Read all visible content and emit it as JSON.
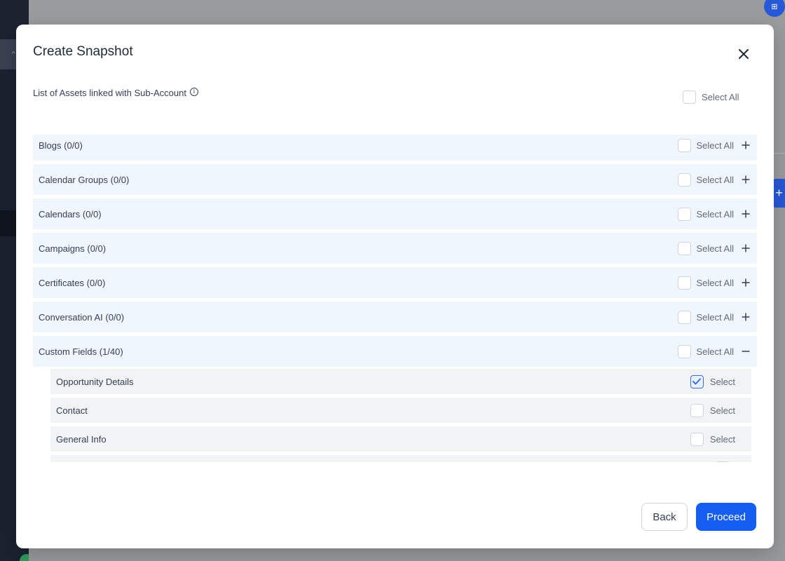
{
  "modal": {
    "title": "Create Snapshot",
    "assets_header": "List of Assets linked with Sub-Account",
    "global_select_all": "Select All"
  },
  "groups": [
    {
      "label": "Blogs (0/0)",
      "select_label": "Select All",
      "expanded": false
    },
    {
      "label": "Calendar Groups (0/0)",
      "select_label": "Select All",
      "expanded": false
    },
    {
      "label": "Calendars (0/0)",
      "select_label": "Select All",
      "expanded": false
    },
    {
      "label": "Campaigns (0/0)",
      "select_label": "Select All",
      "expanded": false
    },
    {
      "label": "Certificates (0/0)",
      "select_label": "Select All",
      "expanded": false
    },
    {
      "label": "Conversation AI (0/0)",
      "select_label": "Select All",
      "expanded": false
    },
    {
      "label": "Custom Fields (1/40)",
      "select_label": "Select All",
      "expanded": true
    }
  ],
  "custom_fields_items": [
    {
      "label": "Opportunity Details",
      "select_label": "Select",
      "checked": true
    },
    {
      "label": "Contact",
      "select_label": "Select",
      "checked": false
    },
    {
      "label": "General Info",
      "select_label": "Select",
      "checked": false
    },
    {
      "label": "",
      "select_label": "",
      "checked": false
    }
  ],
  "footer": {
    "back_label": "Back",
    "proceed_label": "Proceed"
  },
  "colors": {
    "primary": "#155eef",
    "group_row_bg": "#f0f6fe",
    "child_row_bg": "#f2f3f5",
    "sidebar_bg": "#1b2230",
    "overlay": "#9a9b9d"
  }
}
